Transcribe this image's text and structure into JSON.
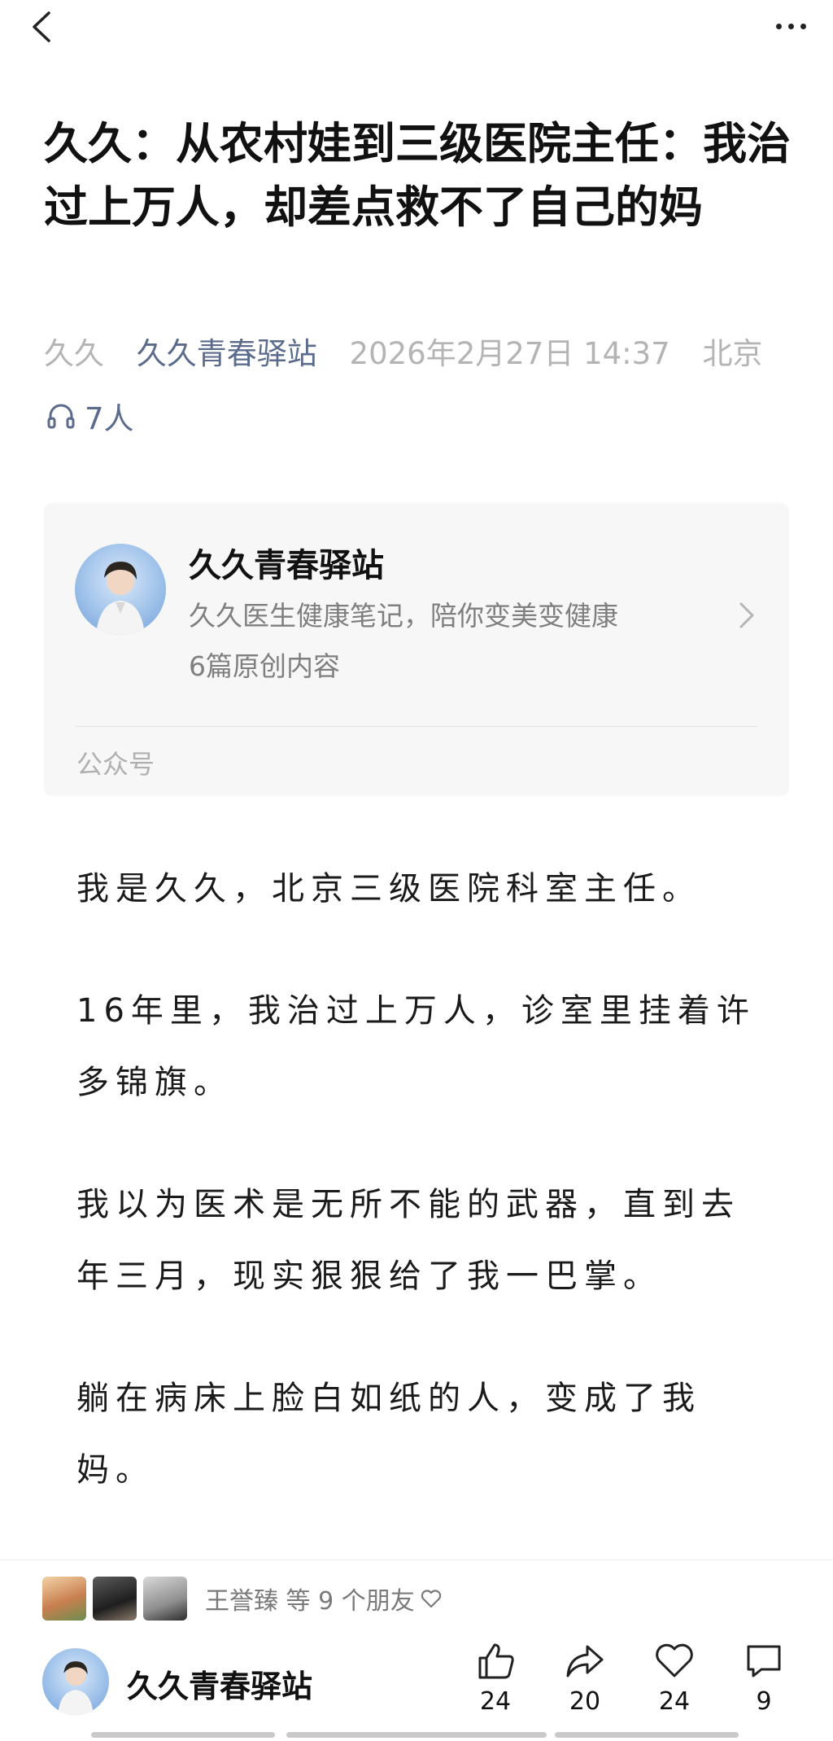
{
  "top_bar": {
    "back_icon": "chevron-left-icon",
    "more_icon": "more-horizontal-icon"
  },
  "article": {
    "title": "久久：从农村娃到三级医院主任：我治过上万人，却差点救不了自己的妈",
    "author": "久久",
    "account": "久久青春驿站",
    "date": "2026年2月27日 14:37",
    "location": "北京",
    "listeners": "7人"
  },
  "account_card": {
    "name": "久久青春驿站",
    "description": "久久医生健康笔记，陪你变美变健康",
    "count": "6篇原创内容",
    "type": "公众号"
  },
  "body": {
    "paragraphs": [
      "我是久久，北京三级医院科室主任。",
      "16年里，我治过上万人，诊室里挂着许多锦旗。",
      "我以为医术是无所不能的武器，直到去年三月，现实狠狠给了我一巴掌。",
      "躺在病床上脸白如纸的人，变成了我妈。"
    ]
  },
  "bottom_bar": {
    "friends_text": "王誉臻 等 9 个朋友",
    "account_name": "久久青春驿站",
    "like_count": "24",
    "share_count": "20",
    "favorite_count": "24",
    "comment_count": "9"
  },
  "colors": {
    "accent_link": "#5b6b8c",
    "meta_gray": "#b4b4b4",
    "card_bg": "#f7f7f7"
  }
}
